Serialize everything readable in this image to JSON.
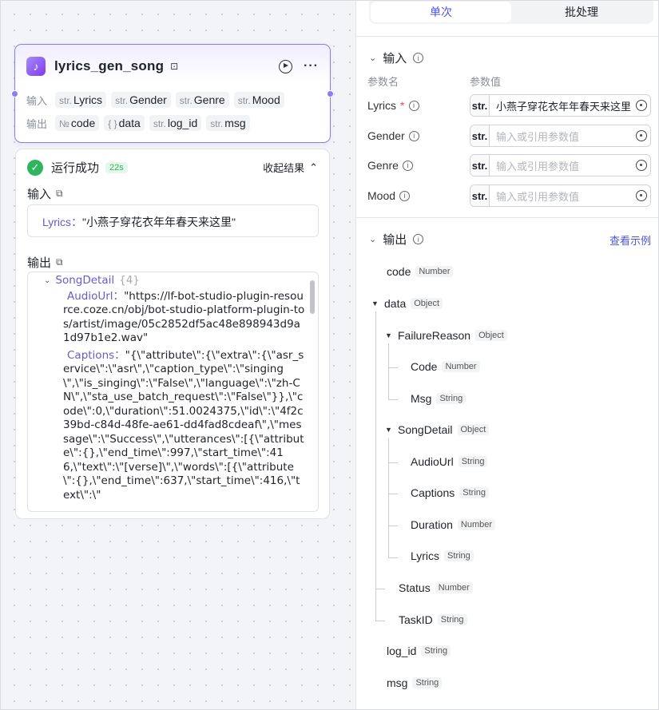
{
  "node": {
    "title": "lyrics_gen_song",
    "inputs_label": "输入",
    "outputs_label": "输出",
    "inputs": [
      {
        "type": "str.",
        "name": "Lyrics"
      },
      {
        "type": "str.",
        "name": "Gender"
      },
      {
        "type": "str.",
        "name": "Genre"
      },
      {
        "type": "str.",
        "name": "Mood"
      }
    ],
    "outputs": [
      {
        "type": "№",
        "name": "code"
      },
      {
        "type": "{ }",
        "name": "data"
      },
      {
        "type": "str.",
        "name": "log_id"
      },
      {
        "type": "str.",
        "name": "msg"
      }
    ]
  },
  "result": {
    "status": "运行成功",
    "time": "22s",
    "collapse": "收起结果",
    "input_title": "输入",
    "input_key": "Lyrics：",
    "input_value": "\"小燕子穿花衣年年春天来这里\"",
    "output_title": "输出",
    "song_detail": "SongDetail",
    "song_detail_count": "{4}",
    "audio_key": "AudioUrl：",
    "audio_value": "\"https://lf-bot-studio-plugin-resource.coze.cn/obj/bot-studio-platform-plugin-tos/artist/image/05c2852df5ac48e898943d9a1d97b1e2.wav\"",
    "captions_key": "Captions：",
    "captions_value": "\"{\\\"attribute\\\":{\\\"extra\\\":{\\\"asr_service\\\":\\\"asr\\\",\\\"caption_type\\\":\\\"singing\\\",\\\"is_singing\\\":\\\"False\\\",\\\"language\\\":\\\"zh-CN\\\",\\\"sta_use_batch_request\\\":\\\"False\\\"}},\\\"code\\\":0,\\\"duration\\\":51.0024375,\\\"id\\\":\\\"4f2c39bd-c84d-48fe-ae61-dd4fad8cdeaf\\\",\\\"message\\\":\\\"Success\\\",\\\"utterances\\\":[{\\\"attribute\\\":{},\\\"end_time\\\":997,\\\"start_time\\\":416,\\\"text\\\":\\\"[verse]\\\",\\\"words\\\":[{\\\"attribute\\\":{},\\\"end_time\\\":637,\\\"start_time\\\":416,\\\"text\\\":\\\""
  },
  "panel": {
    "tab_single": "单次",
    "tab_batch": "批处理",
    "input_title": "输入",
    "col_name": "参数名",
    "col_value": "参数值",
    "params": [
      {
        "name": "Lyrics",
        "required": "*",
        "type": "str.",
        "value": "小燕子穿花衣年年春天来这里"
      },
      {
        "name": "Gender",
        "required": "",
        "type": "str.",
        "value": "",
        "placeholder": "输入或引用参数值"
      },
      {
        "name": "Genre",
        "required": "",
        "type": "str.",
        "value": "",
        "placeholder": "输入或引用参数值"
      },
      {
        "name": "Mood",
        "required": "",
        "type": "str.",
        "value": "",
        "placeholder": "输入或引用参数值"
      }
    ],
    "output_title": "输出",
    "example_link": "查看示例",
    "tree": [
      {
        "name": "code",
        "type": "Number"
      },
      {
        "name": "data",
        "type": "Object"
      },
      {
        "name": "FailureReason",
        "type": "Object"
      },
      {
        "name": "Code",
        "type": "Number"
      },
      {
        "name": "Msg",
        "type": "String"
      },
      {
        "name": "SongDetail",
        "type": "Object"
      },
      {
        "name": "AudioUrl",
        "type": "String"
      },
      {
        "name": "Captions",
        "type": "String"
      },
      {
        "name": "Duration",
        "type": "Number"
      },
      {
        "name": "Lyrics",
        "type": "String"
      },
      {
        "name": "Status",
        "type": "Number"
      },
      {
        "name": "TaskID",
        "type": "String"
      },
      {
        "name": "log_id",
        "type": "String"
      },
      {
        "name": "msg",
        "type": "String"
      }
    ]
  }
}
